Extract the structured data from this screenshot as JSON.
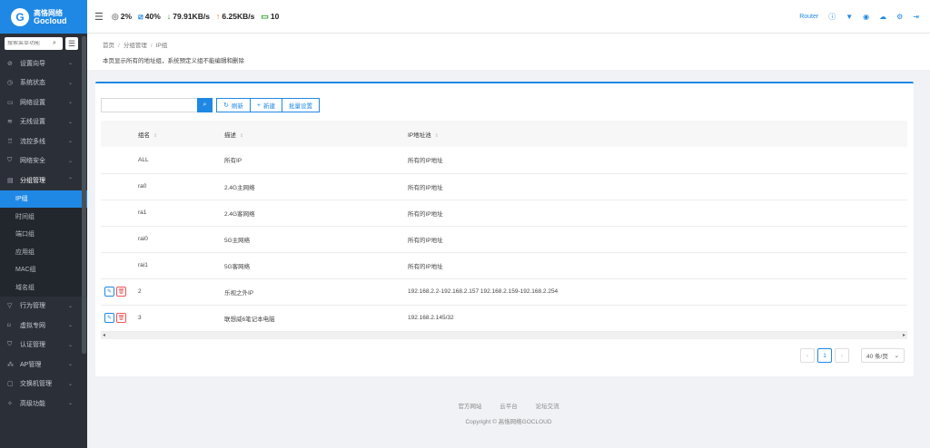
{
  "logo": {
    "cn": "高恪网络",
    "en": "Gocloud"
  },
  "sidebar": {
    "search_placeholder": "搜索菜单功能",
    "items": [
      {
        "label": "设置向导",
        "icon": "⊘"
      },
      {
        "label": "系统状态",
        "icon": "◷"
      },
      {
        "label": "网络设置",
        "icon": "▭"
      },
      {
        "label": "无线设置",
        "icon": "≋"
      },
      {
        "label": "流控多线",
        "icon": "♖"
      },
      {
        "label": "网络安全",
        "icon": "⛉"
      },
      {
        "label": "分组管理",
        "icon": "▤"
      }
    ],
    "sub_items": [
      "IP组",
      "时间组",
      "端口组",
      "应用组",
      "MAC组",
      "域名组"
    ],
    "items_after": [
      {
        "label": "行为管理",
        "icon": "▽"
      },
      {
        "label": "虚拟专网",
        "icon": "⌑"
      },
      {
        "label": "认证管理",
        "icon": "⛉"
      },
      {
        "label": "AP管理",
        "icon": "⁂"
      },
      {
        "label": "交换机管理",
        "icon": "▢"
      },
      {
        "label": "高级功能",
        "icon": "✧"
      }
    ]
  },
  "topbar": {
    "cpu": "2%",
    "mem": "40%",
    "down": "79.91KB/s",
    "up": "6.25KB/s",
    "devices": "10",
    "router": "Router"
  },
  "breadcrumb": {
    "home": "首页",
    "section": "分组管理",
    "page": "IP组"
  },
  "description": "本页显示所有的地址组，系统预定义组不能编辑和删除",
  "toolbar": {
    "refresh": "刷新",
    "new": "新建",
    "batch": "批量设置"
  },
  "table": {
    "headers": {
      "name": "组名",
      "desc": "描述",
      "ip": "IP地址池"
    },
    "rows": [
      {
        "name": "ALL",
        "desc": "所有IP",
        "ip": "所有的IP地址"
      },
      {
        "name": "ra0",
        "desc": "2.4G主网络",
        "ip": "所有的IP地址"
      },
      {
        "name": "ra1",
        "desc": "2.4G客网络",
        "ip": "所有的IP地址"
      },
      {
        "name": "rai0",
        "desc": "5G主网络",
        "ip": "所有的IP地址"
      },
      {
        "name": "rai1",
        "desc": "5G客网络",
        "ip": "所有的IP地址"
      },
      {
        "name": "2",
        "desc": "乐视之外IP",
        "ip": "192.168.2.2-192.168.2.157  192.168.2.159-192.168.2.254"
      },
      {
        "name": "3",
        "desc": "联想威6笔记本电脑",
        "ip": "192.168.2.145/32"
      }
    ]
  },
  "pager": {
    "current": "1",
    "page_size": "40 条/页"
  },
  "footer": {
    "links": [
      "官方网站",
      "云平台",
      "论坛交流"
    ],
    "copyright": "Copyright © 高恪网络GOCLOUD"
  }
}
